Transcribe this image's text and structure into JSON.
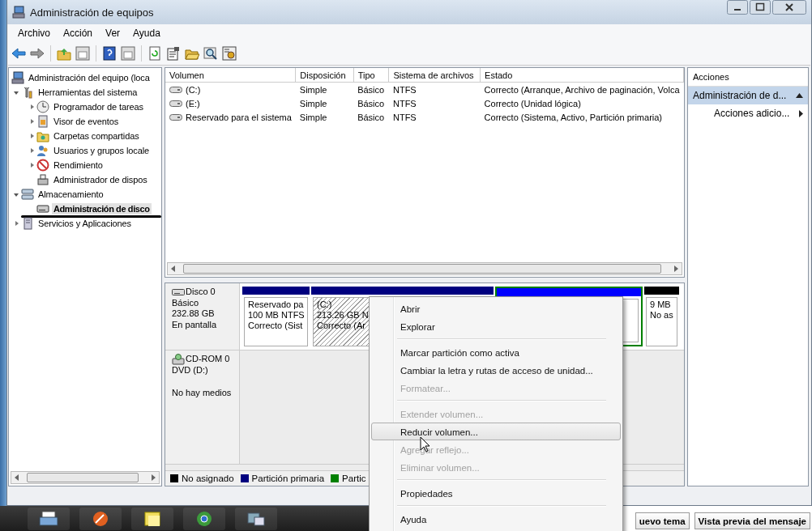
{
  "window": {
    "title": "Administración de equipos"
  },
  "menu": [
    "Archivo",
    "Acción",
    "Ver",
    "Ayuda"
  ],
  "tree": [
    {
      "label": "Administración del equipo (loca",
      "selected": false,
      "underlined": false,
      "children": [
        {
          "label": "Herramientas del sistema",
          "expanded": true,
          "selected": false,
          "underlined": false,
          "children": [
            {
              "label": "Programador de tareas",
              "expanded": false,
              "selected": false,
              "underlined": false
            },
            {
              "label": "Visor de eventos",
              "expanded": false,
              "selected": false,
              "underlined": false
            },
            {
              "label": "Carpetas compartidas",
              "expanded": false,
              "selected": false,
              "underlined": false
            },
            {
              "label": "Usuarios y grupos locale",
              "expanded": false,
              "selected": false,
              "underlined": false
            },
            {
              "label": "Rendimiento",
              "expanded": false,
              "selected": false,
              "underlined": false
            },
            {
              "label": "Administrador de dispos",
              "selected": false,
              "underlined": false
            }
          ]
        },
        {
          "label": "Almacenamiento",
          "expanded": true,
          "selected": false,
          "underlined": false,
          "children": [
            {
              "label": "Administración de disco",
              "selected": true,
              "underlined": true
            }
          ]
        },
        {
          "label": "Servicios y Aplicaciones",
          "expanded": false,
          "selected": false,
          "underlined": false
        }
      ]
    }
  ],
  "volumes": {
    "columns": [
      "Volumen",
      "Disposición",
      "Tipo",
      "Sistema de archivos",
      "Estado"
    ],
    "rows": [
      [
        "(C:)",
        "Simple",
        "Básico",
        "NTFS",
        "Correcto (Arranque, Archivo de paginación, Volca"
      ],
      [
        "(E:)",
        "Simple",
        "Básico",
        "NTFS",
        "Correcto (Unidad lógica)"
      ],
      [
        "Reservado para el sistema",
        "Simple",
        "Básico",
        "NTFS",
        "Correcto (Sistema, Activo, Partición primaria)"
      ]
    ]
  },
  "disks": [
    {
      "kind": "disk",
      "name": "Disco 0",
      "details": [
        "Básico",
        "232.88 GB"
      ],
      "status": "En pantalla",
      "partitions": [
        {
          "kind": "primary",
          "color": "#00007f",
          "selected": false,
          "lines": [
            "Reservado pa",
            "100 MB NTFS",
            "Correcto (Sist"
          ]
        },
        {
          "kind": "primary",
          "color": "#00007f",
          "selected": true,
          "lines": [
            "(C:)",
            "213.26 GB N",
            "Correcto (Ar"
          ]
        },
        {
          "kind": "extended",
          "color": "#0000ff",
          "selected": false
        },
        {
          "kind": "unallocated",
          "color": "#000000",
          "selected": false,
          "lines": [
            "9 MB",
            "No as"
          ]
        }
      ]
    },
    {
      "kind": "cdrom",
      "name": "CD-ROM 0",
      "details": [
        "DVD (D:)"
      ],
      "status": "No hay medios"
    }
  ],
  "legend": [
    {
      "label": "No asignado",
      "color": "#000000"
    },
    {
      "label": "Partición primaria",
      "color": "#00007f"
    },
    {
      "label": "Partic",
      "color": "#008000"
    }
  ],
  "actions": {
    "title": "Acciones",
    "items": [
      {
        "label": "Administración de d...",
        "kind": "section",
        "selected": true
      },
      {
        "label": "Acciones adicio...",
        "kind": "submenu",
        "selected": false
      }
    ]
  },
  "context_menu": [
    {
      "kind": "item",
      "label": "Abrir",
      "disabled": false,
      "highlighted": false
    },
    {
      "kind": "item",
      "label": "Explorar",
      "disabled": false,
      "highlighted": false
    },
    {
      "kind": "separator"
    },
    {
      "kind": "item",
      "label": "Marcar partición como activa",
      "disabled": false,
      "highlighted": false
    },
    {
      "kind": "item",
      "label": "Cambiar la letra y rutas de acceso de unidad...",
      "disabled": false,
      "highlighted": false
    },
    {
      "kind": "item",
      "label": "Formatear...",
      "disabled": true,
      "highlighted": false
    },
    {
      "kind": "separator"
    },
    {
      "kind": "item",
      "label": "Extender volumen...",
      "disabled": true,
      "highlighted": false
    },
    {
      "kind": "item",
      "label": "Reducir volumen...",
      "disabled": false,
      "highlighted": true
    },
    {
      "kind": "item",
      "label": "Agregar reflejo...",
      "disabled": true,
      "highlighted": false
    },
    {
      "kind": "item",
      "label": "Eliminar volumen...",
      "disabled": true,
      "highlighted": false
    },
    {
      "kind": "separator"
    },
    {
      "kind": "item",
      "label": "Propiedades",
      "disabled": false,
      "highlighted": false
    },
    {
      "kind": "separator"
    },
    {
      "kind": "item",
      "label": "Ayuda",
      "disabled": false,
      "highlighted": false
    }
  ],
  "page_buttons": [
    "uevo tema",
    "Vista previa del mensaje"
  ]
}
